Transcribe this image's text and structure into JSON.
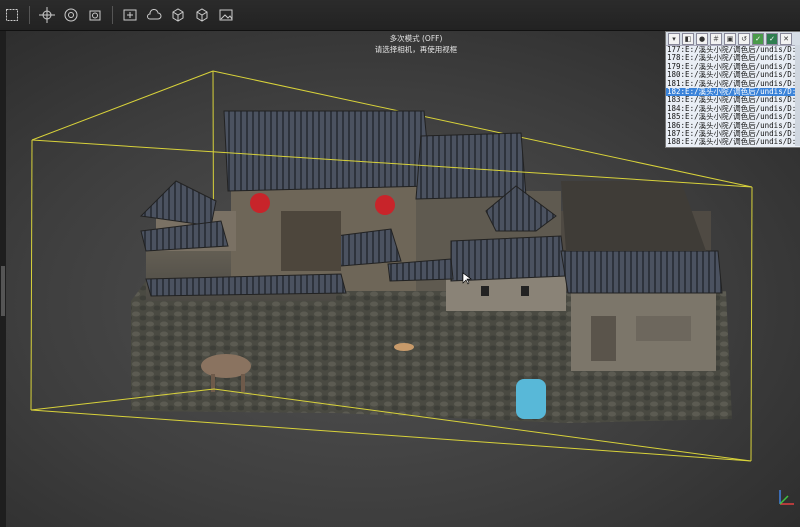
{
  "toolbar": {
    "icons": [
      "square-select-icon",
      "move-icon",
      "rotate-icon",
      "camera-align-icon",
      "orbit-icon",
      "cloud-icon",
      "cube-icon",
      "cube-export-icon",
      "image-icon"
    ]
  },
  "viewport": {
    "mode_title": "多次模式 (OFF)",
    "mode_hint": "请选择相机，再使用视框"
  },
  "image_list": {
    "selected_index": 5,
    "rows": [
      "177:E:/溪头小院/调色后/undis/D:",
      "178:E:/溪头小院/调色后/undis/D:",
      "179:E:/溪头小院/调色后/undis/D:",
      "180:E:/溪头小院/调色后/undis/D:",
      "181:E:/溪头小院/调色后/undis/D:",
      "182:E:/溪头小院/调色后/undis/D:",
      "183:E:/溪头小院/调色后/undis/D:",
      "184:E:/溪头小院/调色后/undis/D:",
      "185:E:/溪头小院/调色后/undis/D:",
      "186:E:/溪头小院/调色后/undis/D:",
      "187:E:/溪头小院/调色后/undis/D:",
      "188:E:/溪头小院/调色后/undis/D:"
    ]
  },
  "colors": {
    "bbox": "#d8d23a",
    "selection": "#3b83d9"
  }
}
